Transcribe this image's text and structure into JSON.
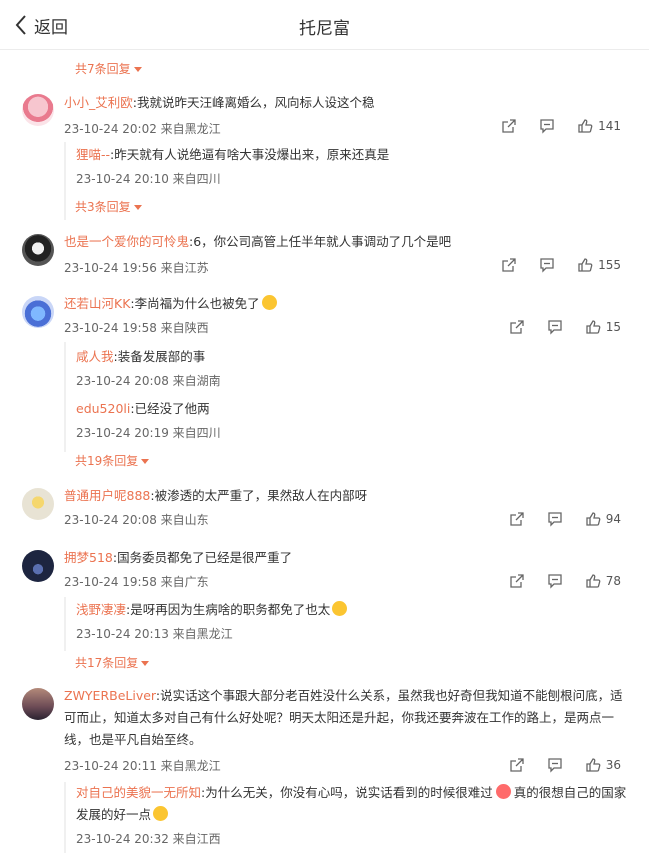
{
  "header": {
    "back_label": "返回",
    "title": "托尼富"
  },
  "top_more": "共7条回复",
  "comments": [
    {
      "user": "小小_艾利欧",
      "text": ":我就说昨天汪峰离婚么，风向标人设这个稳",
      "meta": "23-10-24 20:02 来自黑龙江",
      "likes": "141",
      "replies": [
        {
          "user": "狸喵--",
          "text": ":昨天就有人说绝逼有啥大事没爆出来，原来还真是",
          "meta": "23-10-24 20:10 来自四川"
        }
      ],
      "more": "共3条回复"
    },
    {
      "user": "也是一个爱你的可怜鬼",
      "text": ":6，你公司高管上任半年就人事调动了几个是吧",
      "meta": "23-10-24 19:56 来自江苏",
      "likes": "155"
    },
    {
      "user": "还若山河KK",
      "text": ":李尚福为什么也被免了",
      "meta": "23-10-24 19:58 来自陕西",
      "likes": "15",
      "replies": [
        {
          "user": "咸人我",
          "text": ":装备发展部的事",
          "meta": "23-10-24 20:08 来自湖南"
        },
        {
          "user": "edu520li",
          "text": ":已经没了他两",
          "meta": "23-10-24 20:19 来自四川"
        }
      ],
      "more": "共19条回复"
    },
    {
      "user": "普通用户呢888",
      "text": ":被渗透的太严重了，果然敌人在内部呀",
      "meta": "23-10-24 20:08 来自山东",
      "likes": "94"
    },
    {
      "user": "拥梦518",
      "text": ":国务委员都免了已经是很严重了",
      "meta": "23-10-24 19:58 来自广东",
      "likes": "78",
      "replies": [
        {
          "user": "浅野凄凄",
          "text": ":是呀再因为生病啥的职务都免了也太",
          "meta": "23-10-24 20:13 来自黑龙江"
        }
      ],
      "more": "共17条回复"
    },
    {
      "user": "ZWYERBeLiver",
      "text": ":说实话这个事跟大部分老百姓没什么关系，虽然我也好奇但我知道不能刨根问底，适可而止，知道太多对自己有什么好处呢？明天太阳还是升起，你我还要奔波在工作的路上，是两点一线，也是平凡自始至终。",
      "meta": "23-10-24 20:11 来自黑龙江",
      "likes": "36",
      "replies": [
        {
          "user": "对自己的美貌一无所知",
          "text": ":为什么无关，你没有心吗，说实话看到的时候很难过",
          "text2": "真的很想自己的国家发展的好一点",
          "meta": "23-10-24 20:32 来自江西"
        }
      ]
    }
  ],
  "colors": {
    "link": "#eb7350",
    "meta": "#666666",
    "divider": "#ececec"
  },
  "icons": [
    "chevron-left-icon",
    "share-icon",
    "comment-icon",
    "like-icon"
  ]
}
